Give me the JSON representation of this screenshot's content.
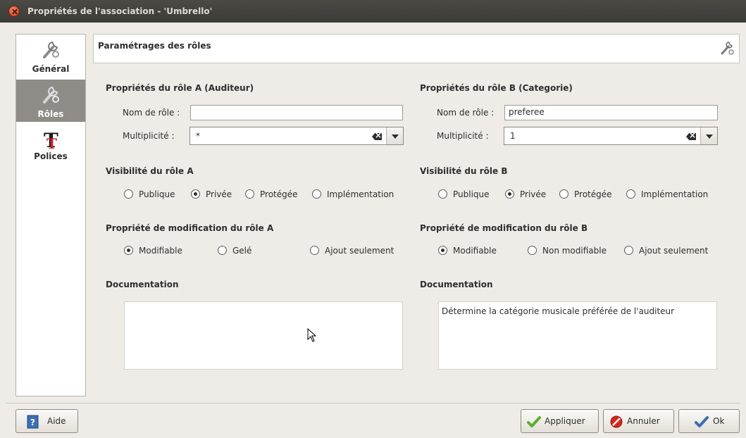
{
  "window": {
    "title": "Propriétés de l'association - 'Umbrello'"
  },
  "sidebar": {
    "items": [
      {
        "label": "Général",
        "icon": "wrench-icon",
        "selected": false
      },
      {
        "label": "Rôles",
        "icon": "wrench-icon",
        "selected": true
      },
      {
        "label": "Polices",
        "icon": "font-icon",
        "selected": false
      }
    ]
  },
  "header": {
    "title": "Paramétrages des rôles",
    "icon": "wrench-icon"
  },
  "roleA": {
    "section_title": "Propriétés du rôle A (Auditeur)",
    "name_label": "Nom de rôle :",
    "name_value": "",
    "multiplicity_label": "Multiplicité :",
    "multiplicity_value": "*",
    "visibility_title": "Visibilité du rôle A",
    "visibility_options": [
      "Publique",
      "Privée",
      "Protégée",
      "Implémentation"
    ],
    "visibility_selected": "Privée",
    "changeability_title": "Propriété de modification du rôle A",
    "changeability_options": [
      "Modifiable",
      "Gelé",
      "Ajout seulement"
    ],
    "changeability_selected": "Modifiable",
    "documentation_title": "Documentation",
    "documentation_value": ""
  },
  "roleB": {
    "section_title": "Propriétés du rôle B (Categorie)",
    "name_label": "Nom de rôle :",
    "name_value": "preferee",
    "multiplicity_label": "Multiplicité :",
    "multiplicity_value": "1",
    "visibility_title": "Visibilité du rôle B",
    "visibility_options": [
      "Publique",
      "Privée",
      "Protégée",
      "Implémentation"
    ],
    "visibility_selected": "Privée",
    "changeability_title": "Propriété de modification du rôle B",
    "changeability_options": [
      "Modifiable",
      "Non modifiable",
      "Ajout seulement"
    ],
    "changeability_selected": "Modifiable",
    "documentation_title": "Documentation",
    "documentation_value": "Détermine la catégorie musicale préférée de l'auditeur"
  },
  "buttons": {
    "help": "Aide",
    "apply": "Appliquer",
    "cancel": "Annuler",
    "ok": "Ok"
  },
  "colors": {
    "titlebar": "#3c3b37",
    "sidebar_selected": "#8f8c88",
    "window_bg": "#efebe7",
    "apply_icon": "#5fae2f",
    "cancel_icon": "#d7261b",
    "help_icon": "#3a6fb4"
  }
}
